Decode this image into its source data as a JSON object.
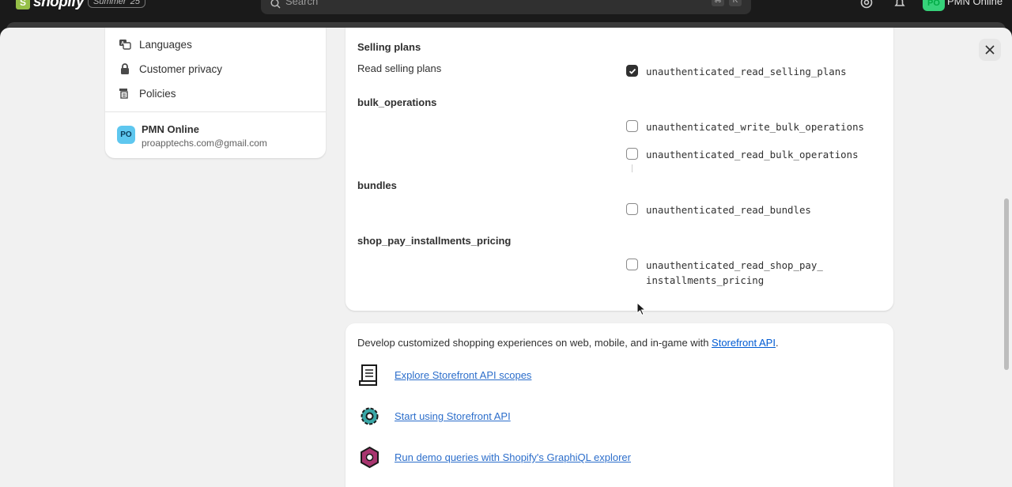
{
  "topbar": {
    "brand": "shopify",
    "edition": "Summer '25",
    "search_placeholder": "Search",
    "shortcut_keys": [
      "⌘",
      "K"
    ],
    "store_label": "PMN Online",
    "avatar_initials": "PO"
  },
  "sidebar": {
    "items": [
      {
        "label": "Languages",
        "icon": "languages-icon"
      },
      {
        "label": "Customer privacy",
        "icon": "lock-icon"
      },
      {
        "label": "Policies",
        "icon": "policies-icon"
      }
    ],
    "store": {
      "initials": "PO",
      "name": "PMN Online",
      "email": "proapptechs.com@gmail.com"
    }
  },
  "scopes": {
    "selling_plans": {
      "title": "Selling plans",
      "subtitle": "Read selling plans",
      "items": [
        {
          "name": "unauthenticated_read_selling_plans",
          "checked": true
        }
      ]
    },
    "bulk_operations": {
      "title": "bulk_operations",
      "items": [
        {
          "name": "unauthenticated_write_bulk_operations",
          "checked": false
        },
        {
          "name": "unauthenticated_read_bulk_operations",
          "checked": false
        }
      ]
    },
    "bundles": {
      "title": "bundles",
      "items": [
        {
          "name": "unauthenticated_read_bundles",
          "checked": false
        }
      ]
    },
    "shop_pay": {
      "title": "shop_pay_installments_pricing",
      "items": [
        {
          "name_line1": "unauthenticated_read_shop_pay_",
          "name_line2": "installments_pricing",
          "checked": false
        }
      ]
    }
  },
  "resources": {
    "intro_text": "Develop customized shopping experiences on web, mobile, and in-game with ",
    "intro_link": "Storefront API",
    "intro_end": ".",
    "links": [
      {
        "label": "Explore Storefront API scopes",
        "icon": "scroll-icon"
      },
      {
        "label": "Start using Storefront API",
        "icon": "gear-icon"
      },
      {
        "label": "Run demo queries with Shopify's GraphiQL explorer",
        "icon": "graphql-icon"
      }
    ]
  },
  "colors": {
    "topbar": "#1a1a1a",
    "modal_bg": "#f1f1f1",
    "link": "#2c6ecb",
    "badge": "#5ec7ef",
    "avatar": "#36d27a"
  }
}
